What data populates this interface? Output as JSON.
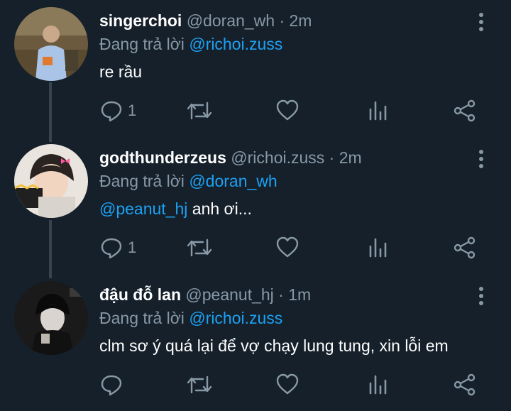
{
  "colors": {
    "background": "#15202b",
    "text": "#ffffff",
    "muted": "#8899a6",
    "link": "#1da1f2",
    "thread_line": "#38444d"
  },
  "tweets": [
    {
      "display_name": "singerchoi",
      "handle_time": "@doran_wh · 2m",
      "reply_prefix": "Đang trả lời",
      "reply_to": "@richoi.zuss",
      "mention": "",
      "text": "re rầu",
      "reply_count": "1",
      "icons": [
        "more-vertical-icon",
        "reply-icon",
        "retweet-icon",
        "like-icon",
        "stats-icon",
        "share-icon"
      ]
    },
    {
      "display_name": "godthunderzeus",
      "handle_time": "@richoi.zuss · 2m",
      "reply_prefix": "Đang trả lời",
      "reply_to": "@doran_wh",
      "mention": "@peanut_hj",
      "text": " anh ơi...",
      "reply_count": "1",
      "icons": [
        "more-vertical-icon",
        "reply-icon",
        "retweet-icon",
        "like-icon",
        "stats-icon",
        "share-icon"
      ]
    },
    {
      "display_name": "đậu đỗ lan",
      "handle_time": "@peanut_hj · 1m",
      "reply_prefix": "Đang trả lời",
      "reply_to": "@richoi.zuss",
      "mention": "",
      "text": "clm sơ ý quá lại để vợ chạy lung tung, xin lỗi em",
      "reply_count": "",
      "icons": [
        "more-vertical-icon",
        "reply-icon",
        "retweet-icon",
        "like-icon",
        "stats-icon",
        "share-icon"
      ]
    }
  ]
}
